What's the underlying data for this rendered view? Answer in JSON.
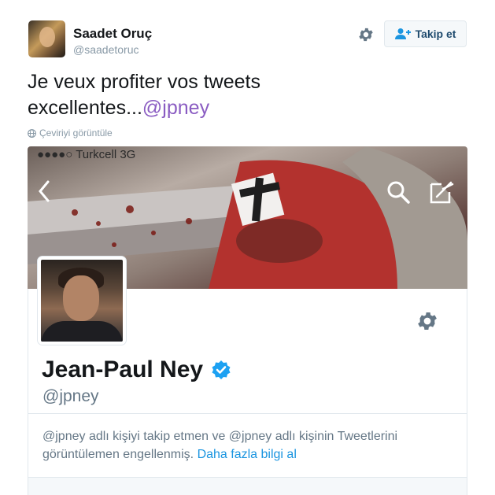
{
  "tweet": {
    "author_name": "Saadet Oruç",
    "author_handle": "@saadetoruc",
    "follow_label": "Takip et",
    "text_line1": "Je veux profiter vos tweets",
    "text_line2": "excellentes...",
    "mention": "@jpney",
    "translate_label": "Çeviriyi görüntüle"
  },
  "card": {
    "status_bar": "●●●●○ Turkcell  3G",
    "profile_name": "Jean-Paul Ney",
    "profile_handle": "@jpney",
    "blocked_text": "@jpney adlı kişiyi takip etmen ve @jpney adlı kişinin Tweetlerini görüntülemen engellenmiş.",
    "learn_more": "Daha fazla bilgi al"
  },
  "icons": {
    "settings": "gear-icon",
    "follow": "add-user-icon",
    "globe": "globe-icon",
    "verified": "verified-badge-icon",
    "back": "chevron-left-icon",
    "search": "search-icon",
    "compose": "compose-icon"
  },
  "colors": {
    "mention": "#8a5cc2",
    "link": "#1b95e0",
    "verified": "#1da1f2",
    "muted": "#657786"
  }
}
